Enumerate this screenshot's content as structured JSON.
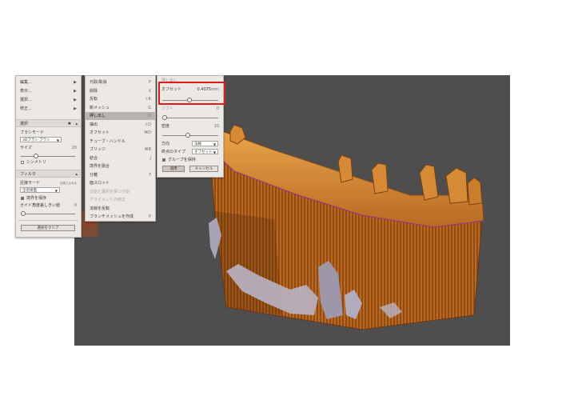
{
  "colors": {
    "viewport_bg": "#4e4e4e",
    "panel_bg": "#ece9e4",
    "model_orange": "#b8621a",
    "model_light": "#e09a3c",
    "scan_gray": "#b8b4c4",
    "highlight_box": "#e01a17"
  },
  "left_panel": {
    "menu": [
      {
        "label": "編集..."
      },
      {
        "label": "表示..."
      },
      {
        "label": "選択..."
      },
      {
        "label": "修正..."
      }
    ],
    "select_section": {
      "title": "選択",
      "brush_mode_label": "ブラシモード",
      "brush_mode_value": "3Dブラシ ブラシ",
      "size_label": "サイズ",
      "size_value": "20",
      "size_fraction": 0.25,
      "symmetry_label": "シンメトリ",
      "symmetry_checked": false
    },
    "filter_section": {
      "title": "フィルタ",
      "mode_label": "近接モード",
      "mode_hint": "近接で止める",
      "mode_value": "全近接面",
      "check1_label": "境界を保存",
      "check1_checked": true,
      "angle_label": "ガイド角度差しきい値",
      "angle_value": "0",
      "angle_fraction": 0.0
    },
    "clear_button": "選択をクリア"
  },
  "edit_menu": {
    "items": [
      {
        "label": "元取/取消",
        "key": "F"
      },
      {
        "label": "削除",
        "key": "X"
      },
      {
        "label": "反転",
        "key": "⇧R"
      },
      {
        "label": "新メッシュ",
        "key": "G"
      },
      {
        "label": "押し出し",
        "key": "D",
        "highlighted": true
      },
      {
        "label": "抽出",
        "key": "⇧D"
      },
      {
        "label": "オフセット",
        "key": "⌘D"
      },
      {
        "label": "チューブ・ハンドル",
        "key": ""
      },
      {
        "label": "ブリッジ",
        "key": "⌘B"
      },
      {
        "label": "結合",
        "key": "J"
      },
      {
        "label": "境界を融合",
        "key": ""
      },
      {
        "label": "分離",
        "key": "Y"
      },
      {
        "label": "面スロット",
        "key": ""
      },
      {
        "label": "分割と選択を保つ分割",
        "key": "",
        "disabled": true
      },
      {
        "label": "アライメントの修正",
        "key": "",
        "disabled": true
      },
      {
        "label": "法線を反転",
        "key": ""
      },
      {
        "label": "ブランチメッシュを作成",
        "key": "P"
      }
    ]
  },
  "extrude_panel": {
    "title": "押し出し",
    "offset_label": "オフセット",
    "offset_value": "0.4075",
    "offset_unit": "mm",
    "offset_fraction": 0.48,
    "param2_label": "ソフト",
    "param2_value": "0",
    "param2_fraction": 0.0,
    "density_label": "密度",
    "density_value": "20",
    "density_fraction": 0.45,
    "direction_label": "方向",
    "direction_value": "法線",
    "end_type_label": "終点のタイプ",
    "end_type_value": "オフセット",
    "group_label": "グループを保持",
    "group_checked": true,
    "apply_button": "適用",
    "cancel_button": "キャンセル"
  }
}
